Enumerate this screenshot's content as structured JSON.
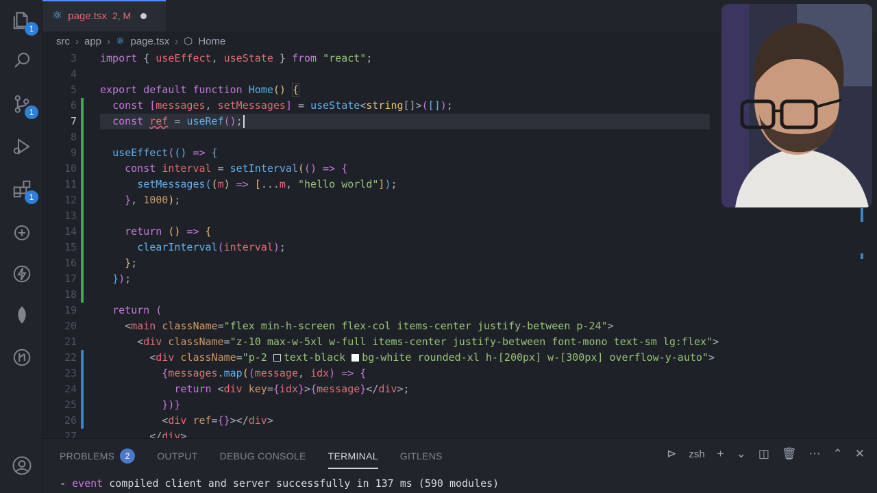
{
  "tab": {
    "react_glyph": "⚛",
    "filename": "page.tsx",
    "status": "2, M"
  },
  "breadcrumb": {
    "items": [
      "src",
      "app",
      "page.tsx",
      "Home"
    ]
  },
  "activity_badges": {
    "explorer": "1",
    "scm": "1",
    "extensions": "1"
  },
  "editor": {
    "line_numbers": [
      "3",
      "4",
      "5",
      "6",
      "7",
      "8",
      "9",
      "10",
      "11",
      "12",
      "13",
      "14",
      "15",
      "16",
      "17",
      "18",
      "19",
      "20",
      "21",
      "22",
      "23",
      "24",
      "25",
      "26",
      "27"
    ]
  },
  "panel": {
    "tabs": [
      "PROBLEMS",
      "OUTPUT",
      "DEBUG CONSOLE",
      "TERMINAL",
      "GITLENS"
    ],
    "problems_count": "2",
    "shell": "zsh",
    "terminal_event": "event",
    "terminal_text": " compiled client and server successfully in 137 ms (590 modules)"
  },
  "colors": {
    "accent": "#528bff",
    "badge": "#2f7fd8",
    "git_added": "#4ba35b",
    "git_modified": "#3f84c9"
  }
}
